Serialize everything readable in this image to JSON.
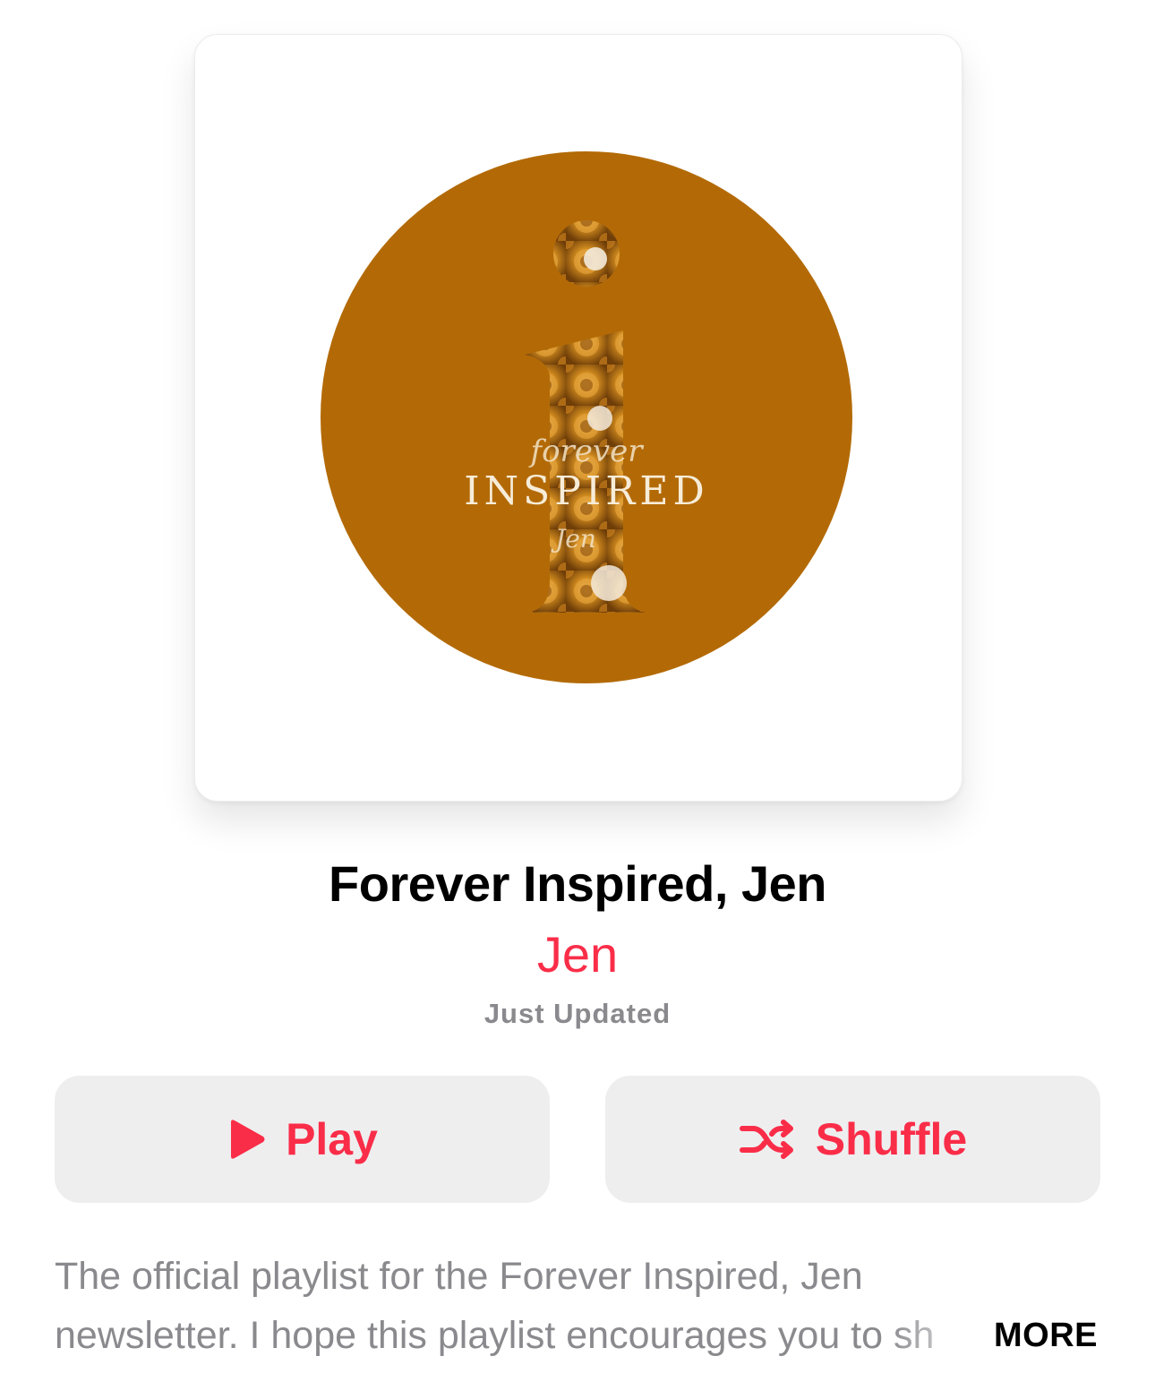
{
  "artwork": {
    "background_color": "#b36a06",
    "script_top": "forever",
    "wordmark": "INSPIRED",
    "script_bottom": "Jen"
  },
  "header": {
    "title": "Forever Inspired, Jen",
    "curator": "Jen",
    "updated": "Just Updated"
  },
  "actions": {
    "play_label": "Play",
    "play_icon": "play-icon",
    "shuffle_label": "Shuffle",
    "shuffle_icon": "shuffle-icon"
  },
  "description": {
    "line1": "The official playlist for the Forever Inspired, Jen",
    "line2": "newsletter. I hope this playlist encourages you to sh",
    "more_label": "MORE"
  },
  "colors": {
    "accent": "#fa2d48",
    "secondary_text": "#8a8a8e",
    "button_bg": "#eeeeef"
  }
}
